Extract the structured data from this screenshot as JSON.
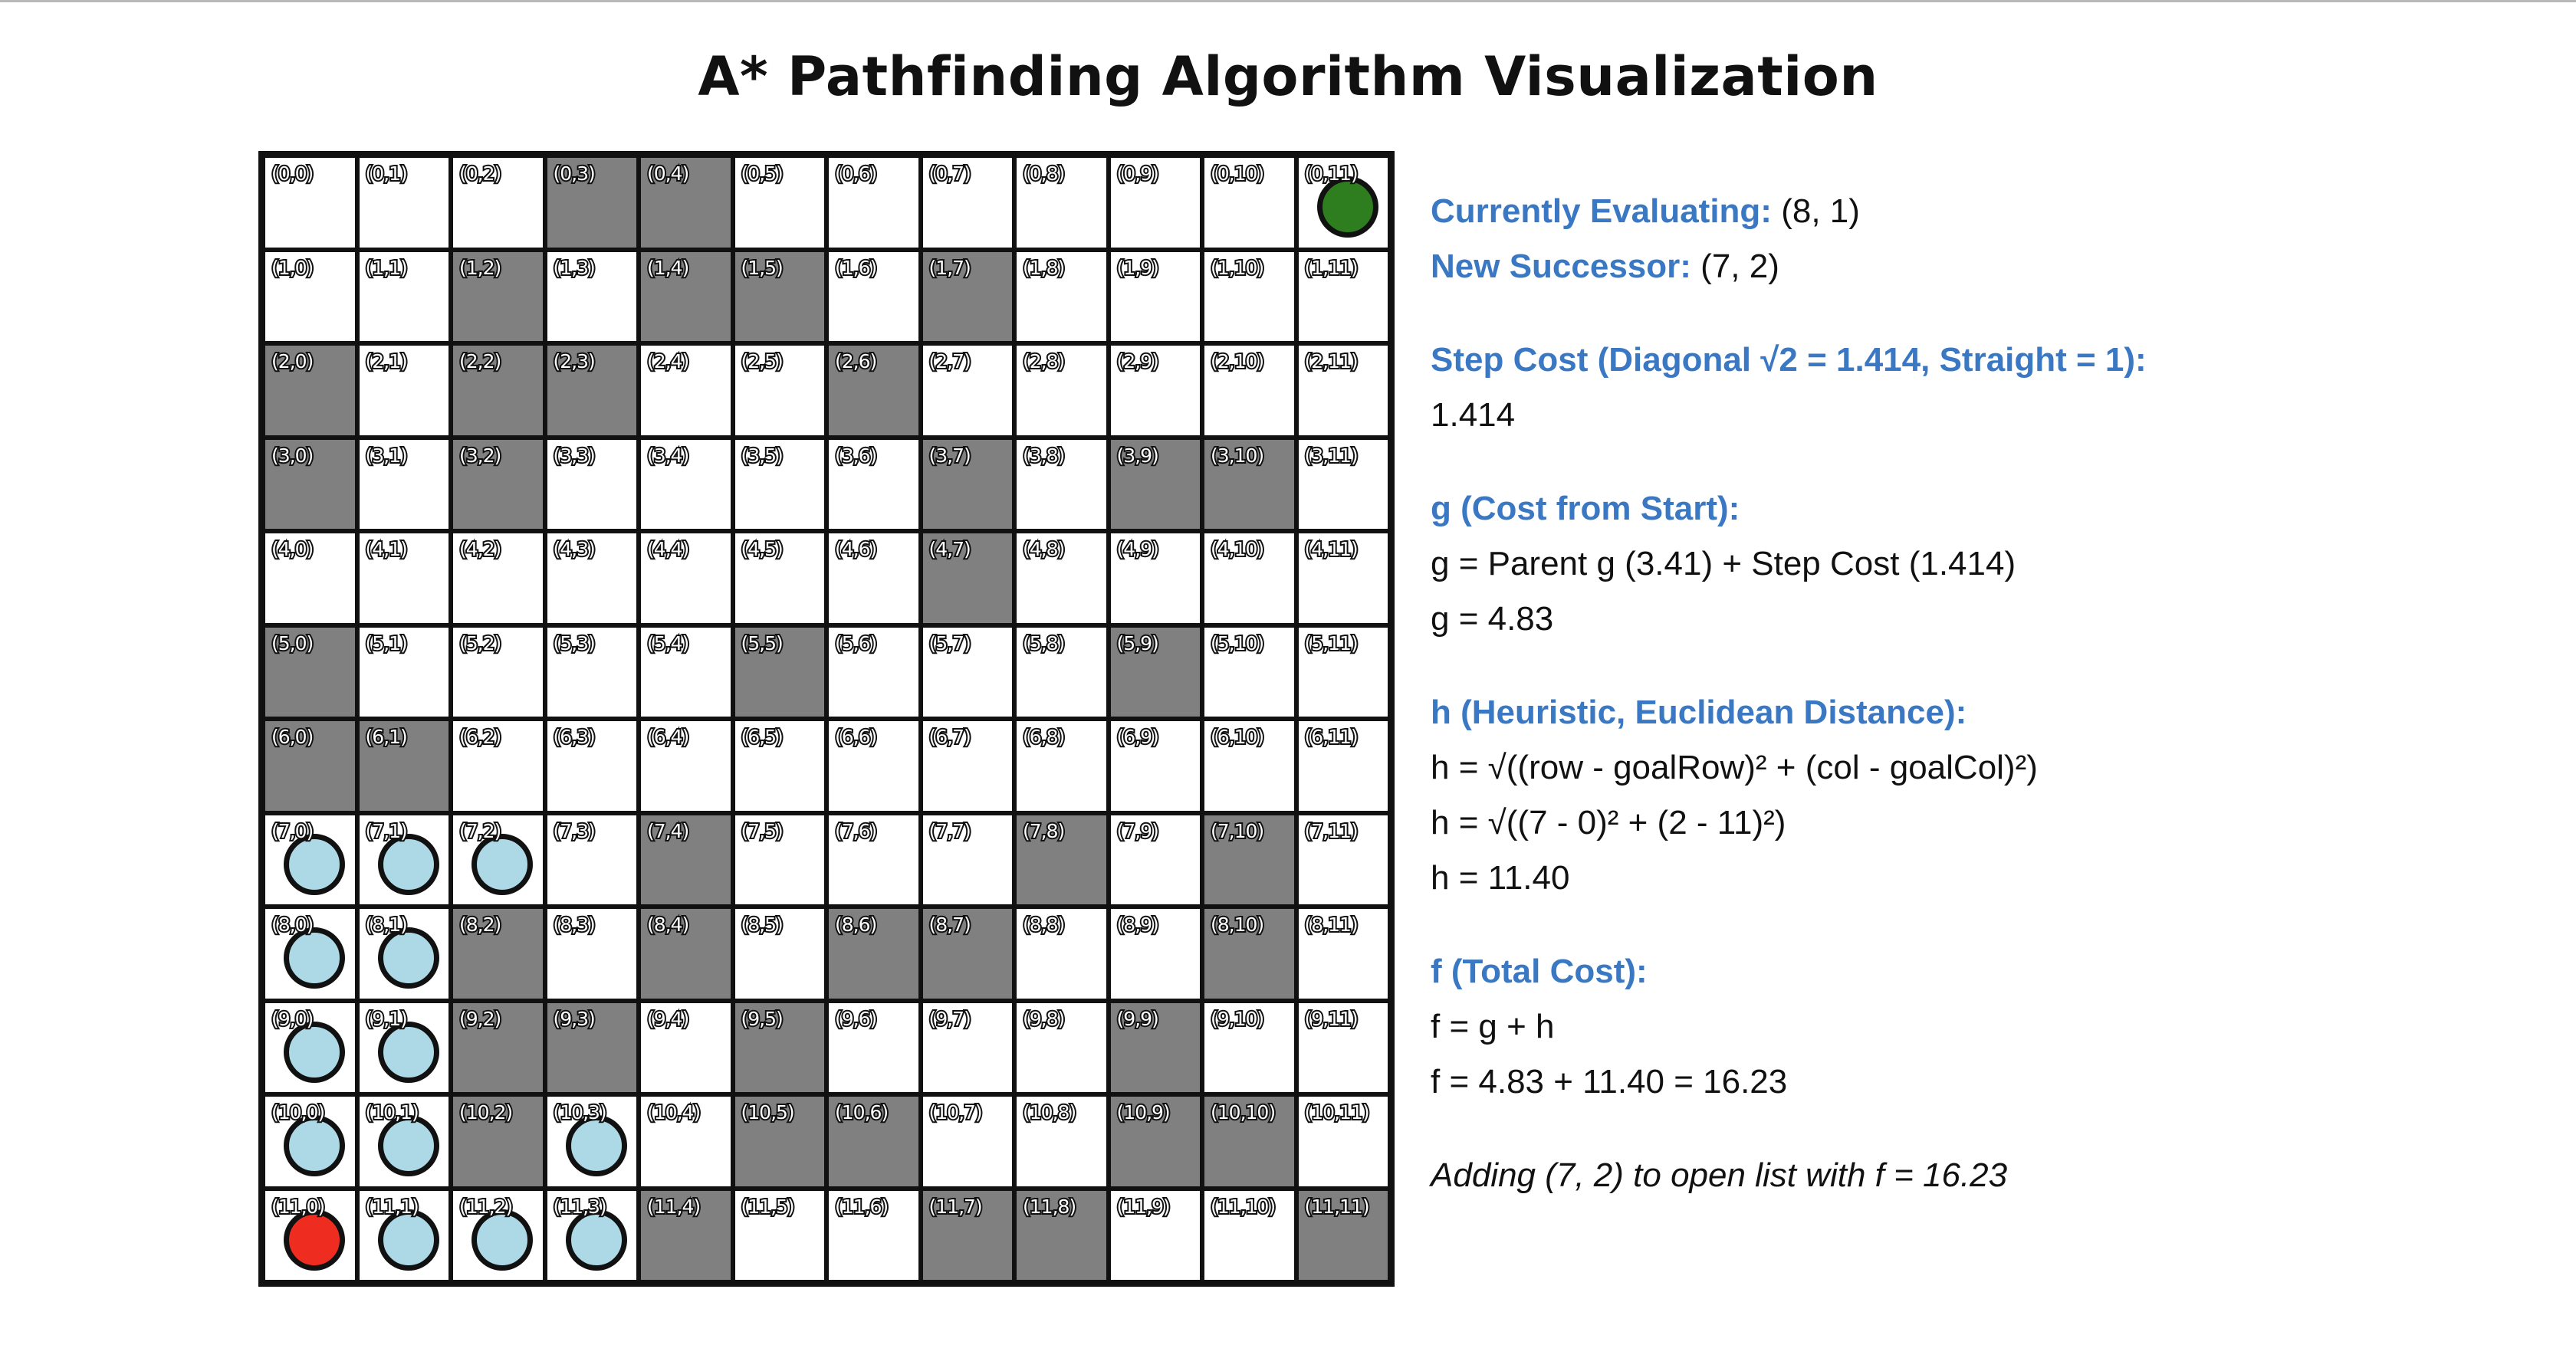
{
  "page": {
    "title": "A* Pathfinding Algorithm Visualization"
  },
  "grid": {
    "rows": 12,
    "cols": 12,
    "walls": [
      [
        0,
        3
      ],
      [
        0,
        4
      ],
      [
        1,
        2
      ],
      [
        1,
        4
      ],
      [
        1,
        5
      ],
      [
        1,
        7
      ],
      [
        2,
        0
      ],
      [
        2,
        2
      ],
      [
        2,
        3
      ],
      [
        2,
        6
      ],
      [
        3,
        0
      ],
      [
        3,
        2
      ],
      [
        3,
        7
      ],
      [
        3,
        9
      ],
      [
        3,
        10
      ],
      [
        4,
        7
      ],
      [
        5,
        0
      ],
      [
        5,
        5
      ],
      [
        5,
        9
      ],
      [
        6,
        0
      ],
      [
        6,
        1
      ],
      [
        7,
        4
      ],
      [
        7,
        8
      ],
      [
        7,
        10
      ],
      [
        8,
        2
      ],
      [
        8,
        4
      ],
      [
        8,
        6
      ],
      [
        8,
        7
      ],
      [
        8,
        10
      ],
      [
        9,
        2
      ],
      [
        9,
        3
      ],
      [
        9,
        5
      ],
      [
        9,
        9
      ],
      [
        10,
        2
      ],
      [
        10,
        5
      ],
      [
        10,
        6
      ],
      [
        10,
        9
      ],
      [
        10,
        10
      ],
      [
        11,
        4
      ],
      [
        11,
        7
      ],
      [
        11,
        8
      ],
      [
        11,
        11
      ]
    ],
    "open_nodes": [
      [
        7,
        0
      ],
      [
        7,
        1
      ],
      [
        7,
        2
      ],
      [
        8,
        0
      ],
      [
        8,
        1
      ],
      [
        9,
        0
      ],
      [
        9,
        1
      ],
      [
        10,
        0
      ],
      [
        10,
        1
      ],
      [
        10,
        3
      ],
      [
        11,
        1
      ],
      [
        11,
        2
      ],
      [
        11,
        3
      ]
    ],
    "start": [
      11,
      0
    ],
    "goal": [
      0,
      11
    ],
    "colors": {
      "wall": "#808080",
      "empty": "#ffffff",
      "open": "#add8e6",
      "start": "#ee2d20",
      "goal": "#2e7d1f",
      "border": "#111111"
    }
  },
  "panel": {
    "accent_color": "#3a78c3",
    "evaluating_label": "Currently Evaluating:",
    "evaluating_value": "(8, 1)",
    "successor_label": "New Successor:",
    "successor_value": "(7, 2)",
    "step_cost_label": "Step Cost (Diagonal √2 = 1.414, Straight = 1):",
    "step_cost_value": "1.414",
    "g_label": "g (Cost from Start):",
    "g_formula": "g = Parent g (3.41) + Step Cost (1.414)",
    "g_value": "g = 4.83",
    "h_label": "h (Heuristic, Euclidean Distance):",
    "h_formula": "h = √((row - goalRow)² + (col - goalCol)²)",
    "h_substituted": "h = √((7 - 0)² + (2 - 11)²)",
    "h_value": "h = 11.40",
    "f_label": "f (Total Cost):",
    "f_formula": "f = g + h",
    "f_value": "f = 4.83 + 11.40 = 16.23",
    "status_message": "Adding (7, 2) to open list with f = 16.23"
  }
}
